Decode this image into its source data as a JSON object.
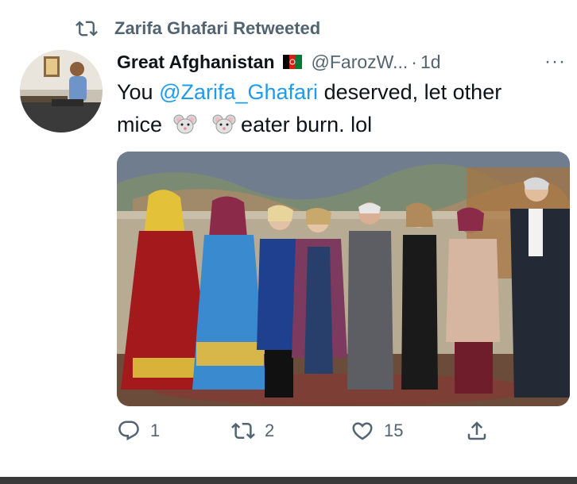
{
  "retweet": {
    "icon": "retweet-icon",
    "text": "Zarifa Ghafari Retweeted"
  },
  "tweet": {
    "display_name": "Great Afghanistan",
    "flag_icon": "afghanistan-flag-icon",
    "handle": "@FarozW...",
    "separator": "·",
    "time": "1d",
    "more_label": "···",
    "text": {
      "part1": "You ",
      "mention": "@Zarifa_Ghafari",
      "part2": " deserved, let other",
      "part3": "mice",
      "part4": "eater burn. lol"
    },
    "emojis": [
      "mouse-face-icon",
      "mouse-face-icon"
    ]
  },
  "media": {
    "description_icon": "group-photo-image"
  },
  "actions": {
    "reply": {
      "icon": "reply-icon",
      "count": "1"
    },
    "retweet": {
      "icon": "retweet-icon",
      "count": "2"
    },
    "like": {
      "icon": "heart-icon",
      "count": "15"
    },
    "share": {
      "icon": "share-icon"
    }
  },
  "colors": {
    "accent": "#1d9bf0",
    "muted": "#536471",
    "text": "#0f1419"
  }
}
